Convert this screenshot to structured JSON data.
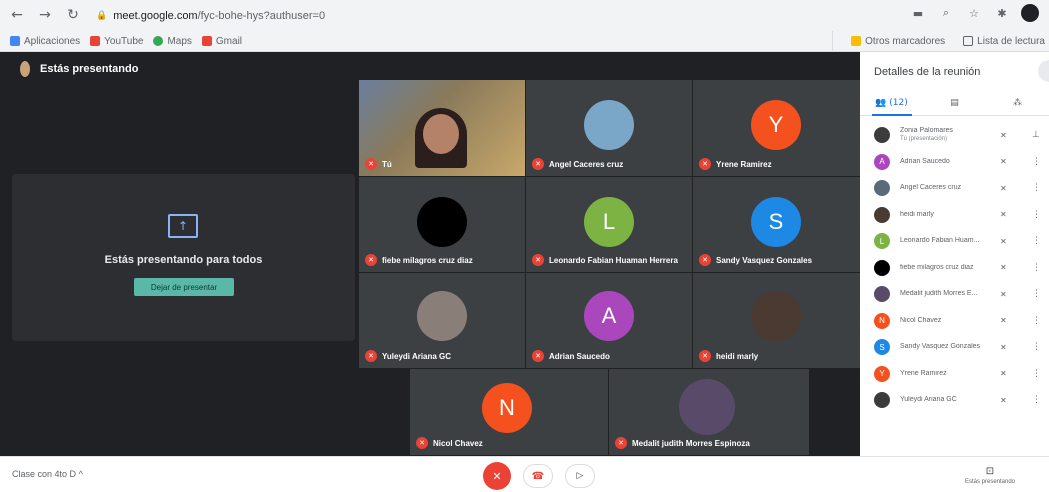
{
  "browser": {
    "url_domain": "meet.google.com",
    "url_path": "/fyc-bohe-hys?authuser=0",
    "bookmarks": [
      {
        "label": "Aplicaciones",
        "color": "#4285f4"
      },
      {
        "label": "YouTube",
        "color": "#ea4335"
      },
      {
        "label": "Maps",
        "color": "#34a853"
      },
      {
        "label": "Gmail",
        "color": "#ea4335"
      }
    ],
    "other_bookmarks": "Otros marcadores",
    "reading_list": "Lista de lectura"
  },
  "meet": {
    "presenting_label": "Estás presentando",
    "present_card_title": "Estás presentando para todos",
    "stop_presenting": "Dejar de presentar",
    "tiles": [
      {
        "name": "Tú",
        "kind": "video"
      },
      {
        "name": "Angel Caceres cruz",
        "kind": "photo",
        "color": "#7aa7c7"
      },
      {
        "name": "Yrene Ramirez",
        "kind": "letter",
        "letter": "Y",
        "color": "#f4511e"
      },
      {
        "name": "fiebe milagros cruz diaz",
        "kind": "photo",
        "color": "#000000"
      },
      {
        "name": "Leonardo Fabian Huaman Herrera",
        "kind": "letter",
        "letter": "L",
        "color": "#7cb342"
      },
      {
        "name": "Sandy Vasquez Gonzales",
        "kind": "letter",
        "letter": "S",
        "color": "#1e88e5"
      },
      {
        "name": "Yuleydi Ariana GC",
        "kind": "photo",
        "color": "#8a7f78"
      },
      {
        "name": "Adrian Saucedo",
        "kind": "letter",
        "letter": "A",
        "color": "#ab47bc"
      },
      {
        "name": "heidi marly",
        "kind": "photo",
        "color": "#4a3a32"
      },
      {
        "name": "Nicol Chavez",
        "kind": "letter",
        "letter": "N",
        "color": "#f4511e"
      },
      {
        "name": "Medalit judith Morres Espinoza",
        "kind": "photo",
        "color": "#5a4a6a"
      }
    ]
  },
  "panel": {
    "title": "Detalles de la reunión",
    "tab_people": "(12)",
    "participants": [
      {
        "name": "Zonia Palomares",
        "sub": "Tú (presentación)",
        "avatar_color": "#3c3c3c",
        "letter": ""
      },
      {
        "name": "Adrian Saucedo",
        "sub": "",
        "avatar_color": "#ab47bc",
        "letter": "A"
      },
      {
        "name": "Angel Caceres cruz",
        "sub": "",
        "avatar_color": "#5a6a7a",
        "letter": ""
      },
      {
        "name": "heidi marly",
        "sub": "",
        "avatar_color": "#4a3a32",
        "letter": ""
      },
      {
        "name": "Leonardo Fabian Huam...",
        "sub": "",
        "avatar_color": "#7cb342",
        "letter": "L"
      },
      {
        "name": "fiebe milagros cruz diaz",
        "sub": "",
        "avatar_color": "#000000",
        "letter": ""
      },
      {
        "name": "Medalit judith Morres E...",
        "sub": "",
        "avatar_color": "#5a4a6a",
        "letter": ""
      },
      {
        "name": "Nicol Chavez",
        "sub": "",
        "avatar_color": "#f4511e",
        "letter": "N"
      },
      {
        "name": "Sandy Vasquez Gonzales",
        "sub": "",
        "avatar_color": "#1e88e5",
        "letter": "S"
      },
      {
        "name": "Yrene Ramirez",
        "sub": "",
        "avatar_color": "#f4511e",
        "letter": "Y"
      },
      {
        "name": "Yuleydi Ariana GC",
        "sub": "",
        "avatar_color": "#3c3c3c",
        "letter": ""
      }
    ]
  },
  "bottom": {
    "meeting_name": "Clase con 4to D",
    "presenting_status": "Estás presentando"
  }
}
